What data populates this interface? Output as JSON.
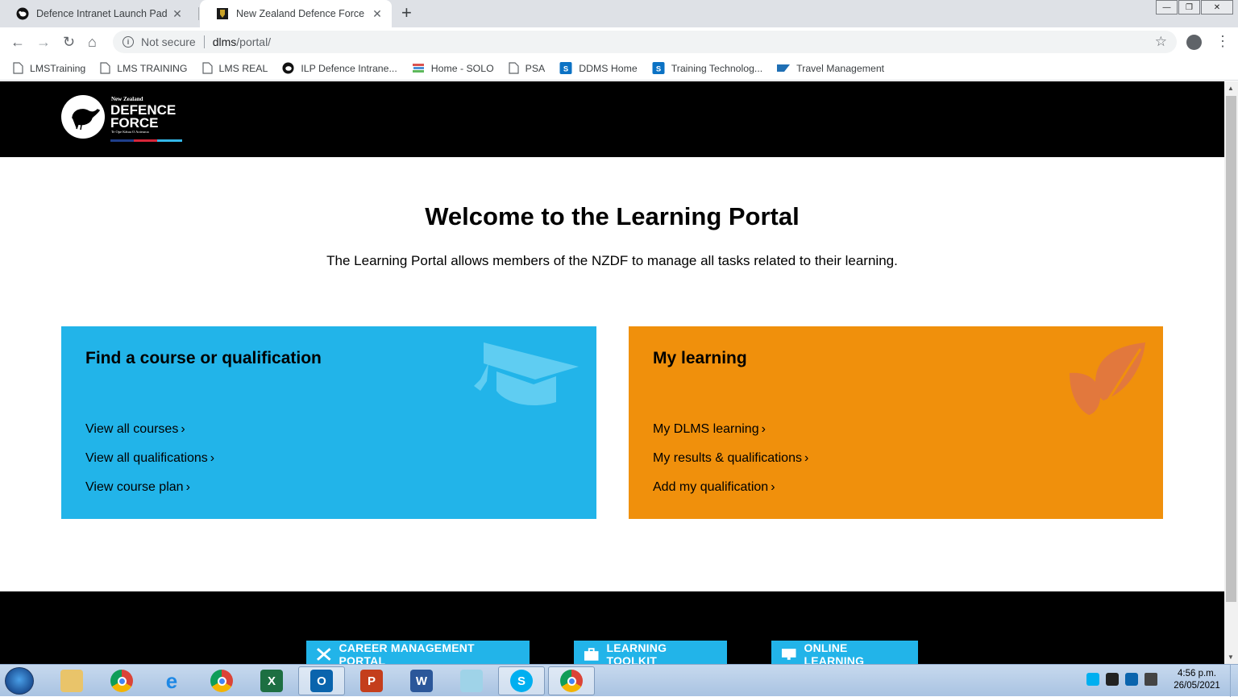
{
  "browser": {
    "tabs": [
      {
        "title": "Defence Intranet Launch Pad",
        "active": false
      },
      {
        "title": "New Zealand Defence Force",
        "active": true
      }
    ],
    "address": {
      "security": "Not secure",
      "host": "dlms",
      "path": "/portal/"
    },
    "bookmarks": [
      {
        "label": "LMSTraining",
        "icon": "page-icon"
      },
      {
        "label": "LMS TRAINING",
        "icon": "page-icon"
      },
      {
        "label": "LMS REAL",
        "icon": "page-icon"
      },
      {
        "label": "ILP Defence Intrane...",
        "icon": "kiwi-icon"
      },
      {
        "label": "Home - SOLO",
        "icon": "books-icon"
      },
      {
        "label": "PSA",
        "icon": "page-icon"
      },
      {
        "label": "DDMS Home",
        "icon": "sharepoint-icon"
      },
      {
        "label": "Training Technolog...",
        "icon": "sharepoint-icon"
      },
      {
        "label": "Travel Management",
        "icon": "sap-icon"
      }
    ]
  },
  "site": {
    "logo": {
      "line1": "New Zealand",
      "line2": "DEFENCE",
      "line3": "FORCE",
      "line4": "Te Ope Kātua O Aotearoa"
    },
    "welcome_title": "Welcome to the Learning Portal",
    "intro": "The Learning Portal allows members of the NZDF to manage all tasks related to their learning.",
    "cards": [
      {
        "title": "Find a course or qualification",
        "color": "#22b4e9",
        "icon": "graduation-cap-icon",
        "links": [
          "View all courses",
          "View all qualifications",
          "View course plan"
        ]
      },
      {
        "title": "My learning",
        "color": "#f0900c",
        "icon": "leaf-icon",
        "links": [
          "My DLMS learning",
          "My results & qualifications",
          "Add my qualification"
        ]
      }
    ],
    "footer_buttons": [
      {
        "label": "CAREER MANAGEMENT PORTAL",
        "icon": "tools-icon"
      },
      {
        "label": "LEARNING TOOLKIT",
        "icon": "briefcase-icon"
      },
      {
        "label": "ONLINE LEARNING",
        "icon": "monitor-icon"
      }
    ]
  },
  "taskbar": {
    "apps": [
      "explorer",
      "chrome",
      "internet-explorer",
      "chrome",
      "excel",
      "outlook",
      "powerpoint",
      "word",
      "notepad",
      "skype",
      "chrome"
    ],
    "time": "4:56 p.m.",
    "date": "26/05/2021"
  }
}
